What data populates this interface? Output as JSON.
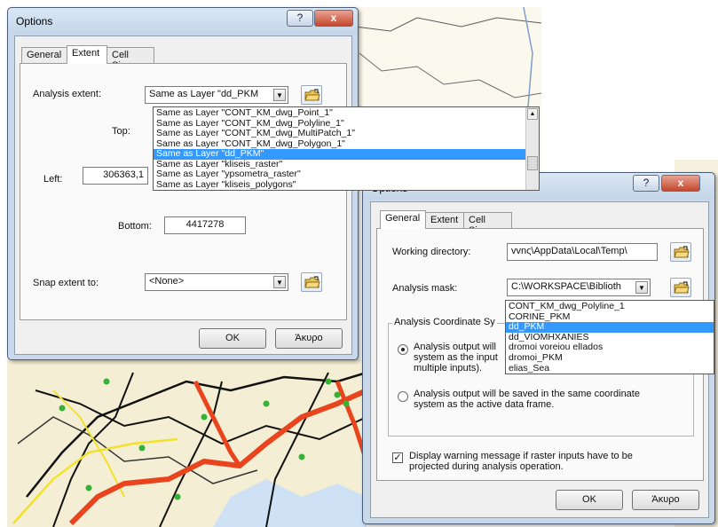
{
  "dialog1": {
    "title": "Options",
    "help_label": "?",
    "close_label": "x",
    "tabs": [
      {
        "label": "General"
      },
      {
        "label": "Extent"
      },
      {
        "label": "Cell Size"
      }
    ],
    "analysis_extent_label": "Analysis extent:",
    "analysis_extent_value": "Same as Layer \"dd_PKM",
    "top_label": "Top:",
    "left_label": "Left:",
    "left_value": "306363,1",
    "bottom_label": "Bottom:",
    "bottom_value": "4417278",
    "dropdown_items": [
      "Same as Layer \"CONT_KM_dwg_Point_1\"",
      "Same as Layer \"CONT_KM_dwg_Polyline_1\"",
      "Same as Layer \"CONT_KM_dwg_MultiPatch_1\"",
      "Same as Layer \"CONT_KM_dwg_Polygon_1\"",
      "Same as Layer \"dd_PKM\"",
      "Same as Layer \"kliseis_raster\"",
      "Same as Layer \"ypsometra_raster\"",
      "Same as Layer \"kliseis_polygons\""
    ],
    "selected_index": 4,
    "snap_label": "Snap extent to:",
    "snap_value": "<None>",
    "ok_label": "OK",
    "cancel_label": "Άκυρο"
  },
  "dialog2": {
    "title": "Options",
    "help_label": "?",
    "close_label": "x",
    "tabs": [
      {
        "label": "General"
      },
      {
        "label": "Extent"
      },
      {
        "label": "Cell Size"
      }
    ],
    "working_dir_label": "Working directory:",
    "working_dir_value": "vvnς\\AppData\\Local\\Temp\\",
    "mask_label": "Analysis mask:",
    "mask_value": "C:\\WORKSPACE\\Biblioth",
    "dropdown_items": [
      "CONT_KM_dwg_Polyline_1",
      "CORINE_PKM",
      "dd_PKM",
      "dd_VIOMHXANIES",
      "dromoi voreiou elIados",
      "dromoi_PKM",
      "elias_Sea"
    ],
    "selected_index": 2,
    "group_label": "Analysis Coordinate Sy",
    "radio1_line1": "Analysis output will",
    "radio1_line2": "system as the input",
    "radio1_line3": "multiple inputs).",
    "radio2_line1": "Analysis output will be saved in the same coordinate",
    "radio2_line2": "system as the active data frame.",
    "checkbox_line1": "Display warning message if raster inputs have to be",
    "checkbox_line2": "projected during analysis operation.",
    "checkbox_mark": "✓",
    "ok_label": "OK",
    "cancel_label": "Άκυρο"
  },
  "colors": {
    "selection": "#3399ff",
    "title_bar": "#c9d9ea",
    "close_button": "#c4472c"
  }
}
